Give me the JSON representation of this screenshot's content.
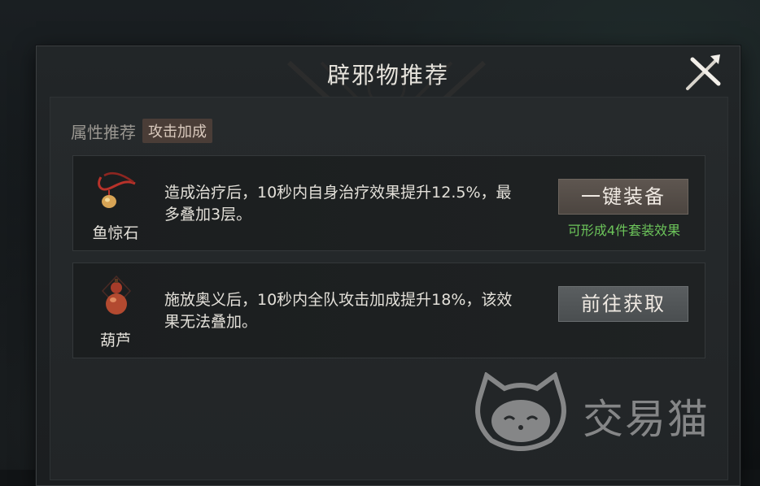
{
  "dialog": {
    "title": "辟邪物推荐"
  },
  "attribute": {
    "label": "属性推荐",
    "tag": "攻击加成"
  },
  "items": [
    {
      "name": "鱼惊石",
      "description": "造成治疗后，10秒内自身治疗效果提升12.5%，最多叠加3层。",
      "button": "一键装备",
      "note": "可形成4件套装效果",
      "icon": "pendant-icon"
    },
    {
      "name": "葫芦",
      "description": "施放奥义后，10秒内全队攻击加成提升18%，该效果无法叠加。",
      "button": "前往获取",
      "icon": "gourd-icon"
    }
  ],
  "watermark": {
    "text": "交易猫",
    "icon": "cat-logo-icon"
  },
  "colors": {
    "note_green": "#6cc45a",
    "tag_bg": "#4a3d37"
  }
}
